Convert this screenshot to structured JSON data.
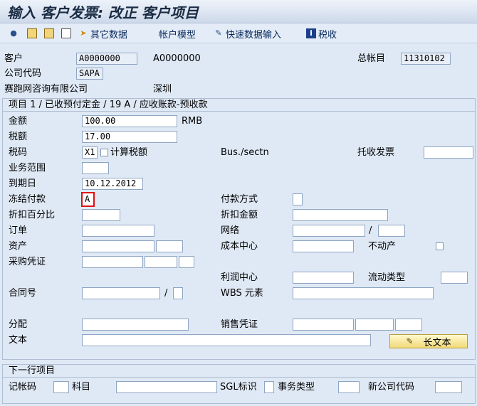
{
  "window": {
    "title": "输入 客户发票: 改正 客户项目"
  },
  "toolbar": {
    "other_data": "其它数据",
    "account_model": "帐户模型",
    "fast_entry": "快速数据输入",
    "tax": "税收"
  },
  "header": {
    "customer_label": "客户",
    "customer_value": "A0000000",
    "customer_value2": "A0000000",
    "gl_label": "总帐目",
    "gl_value": "11310102",
    "company_code_label": "公司代码",
    "company_code_value": "SAPA",
    "company_name": "赛跑网咨询有限公司",
    "city": "深圳"
  },
  "item": {
    "heading": "项目 1 / 已收预付定金 / 19 A / 应收账款-预收款",
    "amount_label": "金额",
    "amount_value": "100.00",
    "currency": "RMB",
    "tax_amount_label": "税额",
    "tax_amount_value": "17.00",
    "tax_code_label": "税码",
    "tax_code_value": "X1",
    "calc_tax_label": "计算税额",
    "bus_sectn_label": "Bus./sectn",
    "collection_invoice_label": "托收发票",
    "business_area_label": "业务范围",
    "due_date_label": "到期日",
    "due_date_value": "10.12.2012",
    "payment_block_label": "冻结付款",
    "payment_block_value": "A",
    "payment_method_label": "付款方式",
    "discount_pct_label": "折扣百分比",
    "discount_amount_label": "折扣金额",
    "order_label": "订单",
    "network_label": "网络",
    "asset_label": "资产",
    "cost_center_label": "成本中心",
    "real_estate_label": "不动产",
    "purchasing_doc_label": "采购凭证",
    "profit_center_label": "利润中心",
    "flow_type_label": "流动类型",
    "contract_label": "合同号",
    "wbs_label": "WBS 元素",
    "assignment_label": "分配",
    "sales_doc_label": "销售凭证",
    "text_label": "文本",
    "long_text_button": "长文本"
  },
  "next_item": {
    "heading": "下一行项目",
    "posting_key_label": "记帐码",
    "account_label": "科目",
    "sgl_label": "SGL标识",
    "trans_type_label": "事务类型",
    "new_company_code_label": "新公司代码"
  }
}
